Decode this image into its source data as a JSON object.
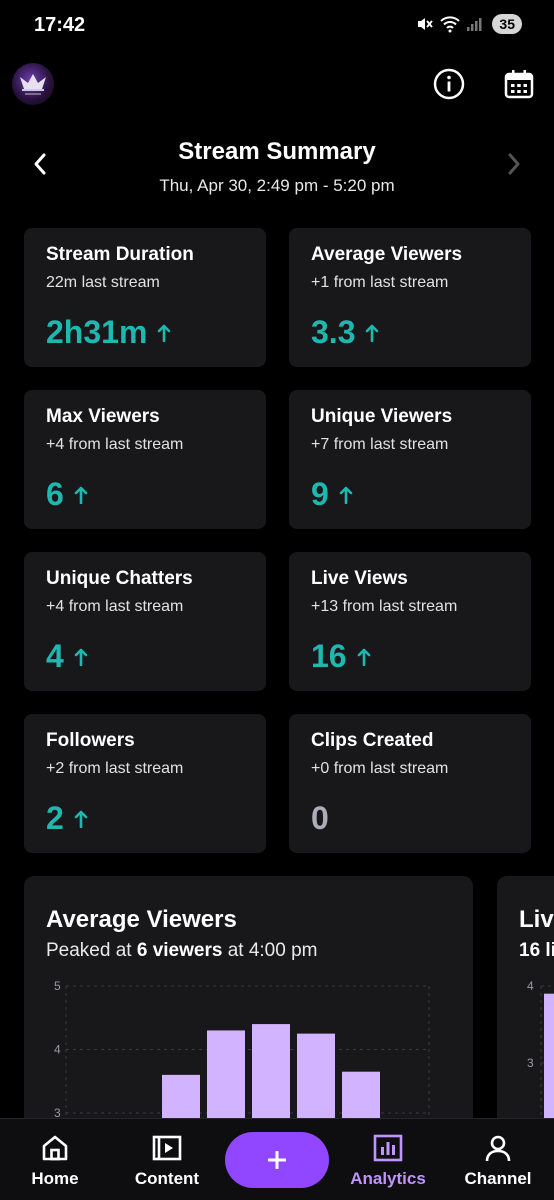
{
  "status": {
    "time": "17:42",
    "battery": "35"
  },
  "header": {
    "title": "Stream Summary",
    "subtitle": "Thu, Apr 30, 2:49 pm - 5:20 pm"
  },
  "stats": [
    {
      "title": "Stream Duration",
      "sub": "22m last stream",
      "value": "2h31m",
      "trend": "up"
    },
    {
      "title": "Average Viewers",
      "sub": "+1 from last stream",
      "value": "3.3",
      "trend": "up"
    },
    {
      "title": "Max Viewers",
      "sub": "+4 from last stream",
      "value": "6",
      "trend": "up"
    },
    {
      "title": "Unique Viewers",
      "sub": "+7 from last stream",
      "value": "9",
      "trend": "up"
    },
    {
      "title": "Unique Chatters",
      "sub": "+4 from last stream",
      "value": "4",
      "trend": "up"
    },
    {
      "title": "Live Views",
      "sub": "+13 from last stream",
      "value": "16",
      "trend": "up"
    },
    {
      "title": "Followers",
      "sub": "+2 from last stream",
      "value": "2",
      "trend": "up"
    },
    {
      "title": "Clips Created",
      "sub": "+0 from last stream",
      "value": "0",
      "trend": "none"
    }
  ],
  "chart_card": {
    "title": "Average Viewers",
    "sub_pre": "Peaked at ",
    "sub_bold": "6 viewers",
    "sub_post": " at 4:00 pm"
  },
  "chart_card2": {
    "title": "Liv",
    "sub": "16 li"
  },
  "chart_data": [
    {
      "type": "bar",
      "title": "Average Viewers",
      "y_ticks": [
        "5",
        "4",
        "3"
      ],
      "ylim": [
        2.7,
        5
      ],
      "values": [
        3.6,
        4.3,
        4.4,
        4.25,
        3.65
      ],
      "bar_color": "#d1b3ff",
      "grid": true
    },
    {
      "type": "bar",
      "title": "Liv",
      "y_ticks": [
        "4",
        "3"
      ],
      "ylim": [
        2.1,
        4
      ],
      "values": [
        3.9
      ],
      "bar_color": "#d1b3ff",
      "grid": true
    }
  ],
  "nav": {
    "items": [
      {
        "label": "Home",
        "icon": "home-icon"
      },
      {
        "label": "Content",
        "icon": "content-icon"
      },
      {
        "label": "Analytics",
        "icon": "analytics-icon",
        "active": true
      },
      {
        "label": "Channel",
        "icon": "channel-icon"
      }
    ],
    "create_icon": "plus-icon"
  },
  "colors": {
    "accent": "#9147ff",
    "positive": "#1fb8b0",
    "card": "#18181b",
    "active": "#bf94ff"
  }
}
